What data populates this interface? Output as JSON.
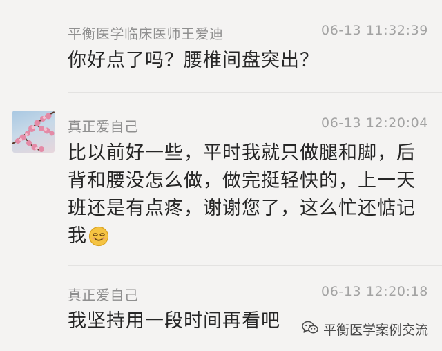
{
  "comments": [
    {
      "author": "平衡医学临床医师王爱迪",
      "time": "06-13 11:32:39",
      "text": "你好点了吗？腰椎间盘突出？"
    },
    {
      "author": "真正爱自己",
      "time": "06-13 12:20:04",
      "text": "比以前好一些，平时我就只做腿和脚，后背和腰没怎么做，做完挺轻快的，上一天班还是有点疼，谢谢您了，这么忙还惦记我",
      "avatar_icon": "cherry-blossom-avatar",
      "emoji_icon": "smiley-emoji-icon"
    },
    {
      "author": "真正爱自己",
      "time": "06-13 12:20:18",
      "text": "我坚持用一段时间再看吧"
    }
  ],
  "watermark": {
    "icon": "wechat-icon",
    "text": "平衡医学案例交流"
  },
  "colors": {
    "background": "#f4f3f2",
    "author": "#8f8f8f",
    "text": "#262626",
    "emoji": "#f5c342"
  }
}
